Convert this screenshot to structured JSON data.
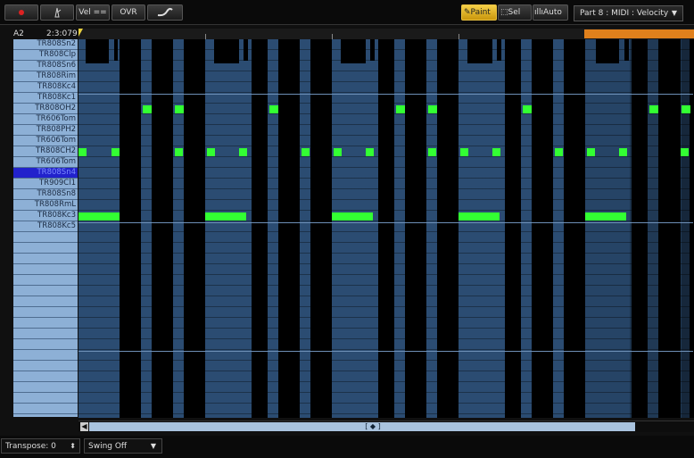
{
  "toolbar": {
    "record_icon": "record-dot-icon",
    "metronome_icon": "metronome-icon",
    "vel_label": "Vel ==",
    "ovr_label": "OVR",
    "shape_icon": "curve-icon",
    "paint_label": "Paint",
    "sel_label": "Sel",
    "auto_label": "Auto",
    "part_dropdown": "Part 8 : MIDI : Velocity"
  },
  "editor": {
    "current_note": "A2",
    "position": "2:3:079",
    "keys": [
      "TR808Sn2",
      "TR808Clp",
      "TR808Sn6",
      "TR808Rim",
      "TR808Kc4",
      "TR808Kc1",
      "TR808OH2",
      "TR606Tom",
      "TR808PH2",
      "TR606Tom",
      "TR808CH2",
      "TR606Tom",
      "TR808Sn4",
      "TR909Cl1",
      "TR808Sn8",
      "TR808RmL",
      "TR808Kc3",
      "TR808Kc5"
    ],
    "selected_key_index": 12,
    "accent_color": "#33ff33"
  },
  "footer": {
    "transpose": "Transpose: 0",
    "swing": "Swing Off"
  }
}
